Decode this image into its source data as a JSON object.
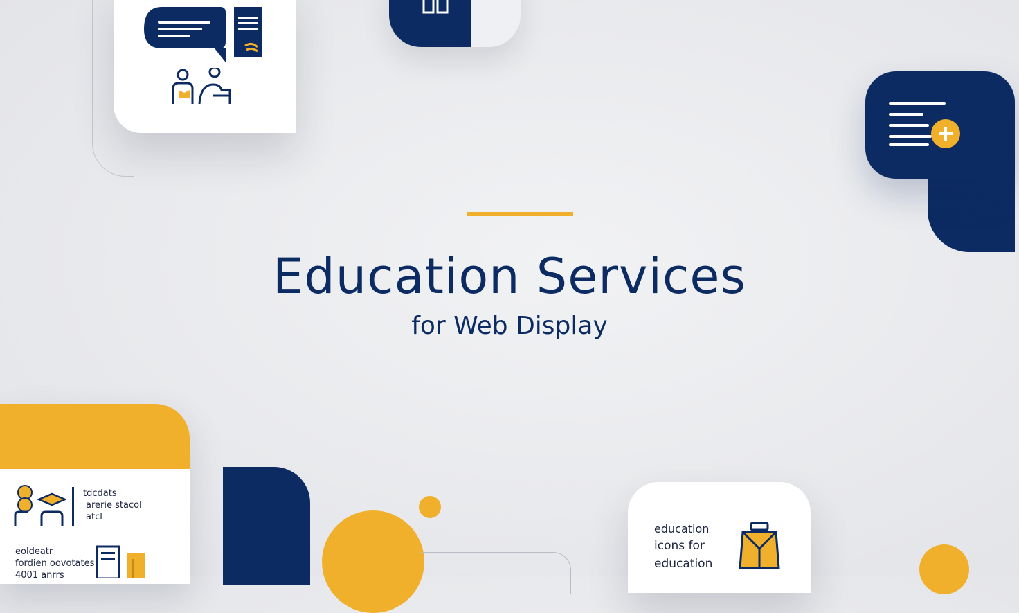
{
  "hero": {
    "title": "Education Services",
    "subtitle": "for Web Display"
  },
  "cards": {
    "bottom_left": {
      "line1": "tdcdats",
      "line2": "arerie stacol",
      "line3": "atcl",
      "line4": "eoldeatr",
      "line5": "fordien oovotates",
      "line6": "4001 anrrs"
    },
    "bottom_right": {
      "line1": "education",
      "line2": "icons for",
      "line3": "education"
    }
  },
  "colors": {
    "navy": "#0d2b63",
    "gold": "#f0b02b",
    "background": "#e8e9ec",
    "card": "#ffffff"
  },
  "icons": [
    "speech-bubble-icon",
    "document-icon",
    "people-icon",
    "document-add-icon",
    "student-icon",
    "graduation-cap-icon",
    "book-icon",
    "bag-icon"
  ]
}
